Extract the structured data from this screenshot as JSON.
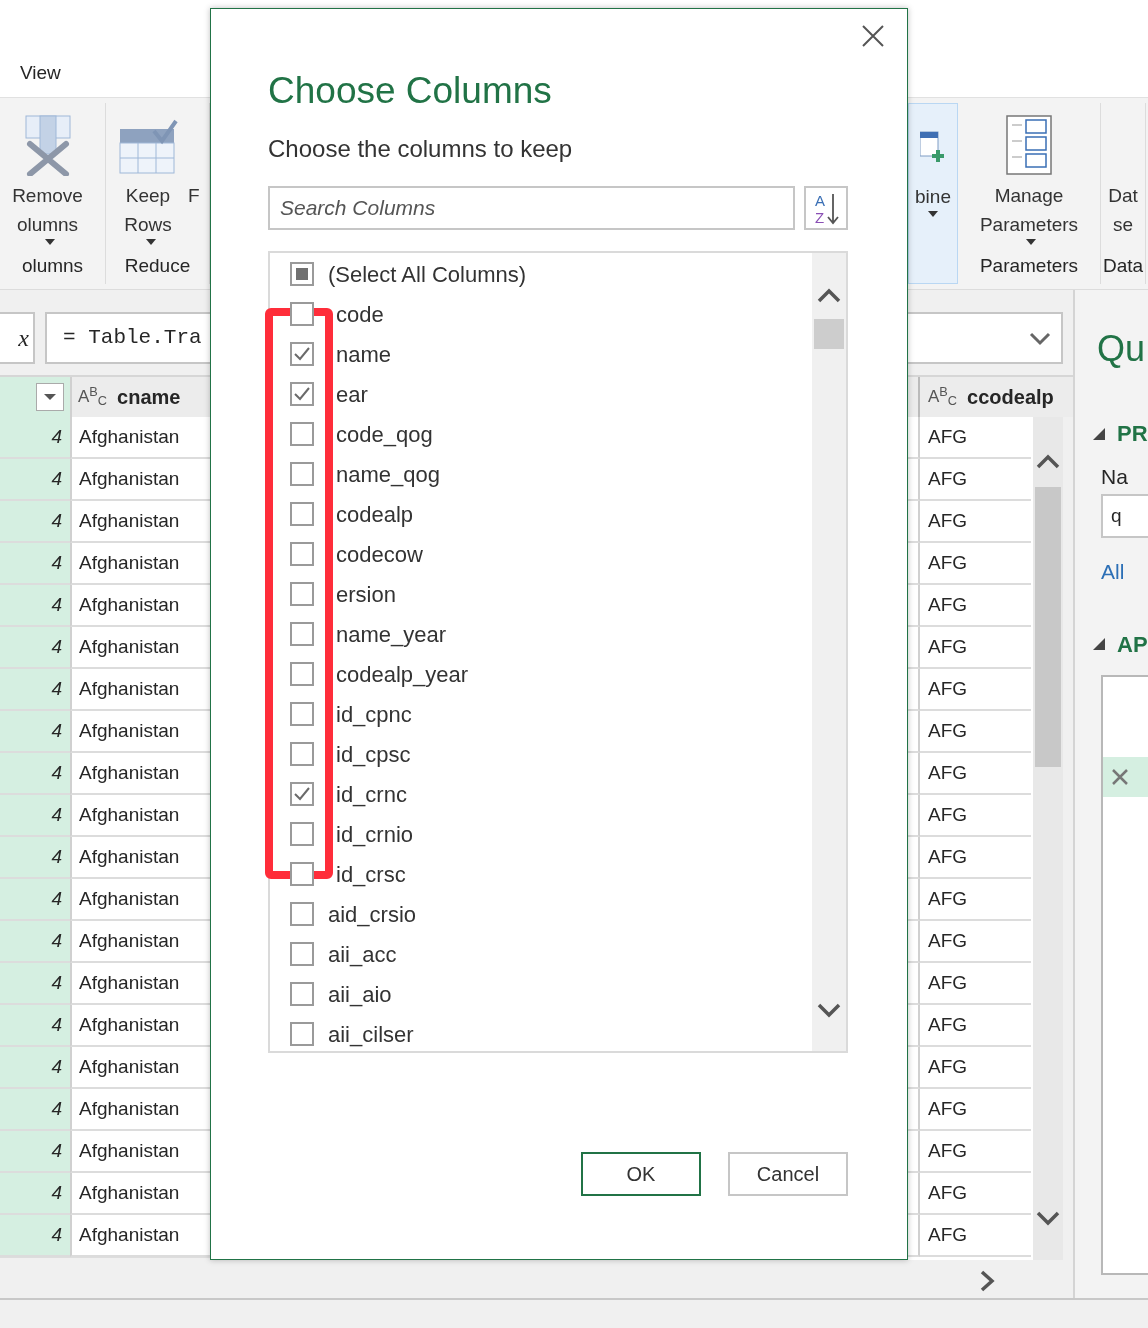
{
  "ribbon": {
    "tab": "View",
    "groups": [
      {
        "label": "olumns",
        "highlighted": false,
        "buttons": [
          {
            "kind": "remove",
            "lines": [
              "Remove",
              "olumns"
            ],
            "dropdown": true
          }
        ]
      },
      {
        "label": "Reduce",
        "highlighted": false,
        "buttons": [
          {
            "kind": "keep",
            "lines": [
              "Keep",
              "Rows"
            ],
            "dropdown": true
          },
          {
            "kind": "text",
            "lines": [
              "F"
            ],
            "dropdown": false
          }
        ]
      },
      {
        "highlighted": true,
        "buttons": [
          {
            "kind": "combine",
            "lines": [
              "bine"
            ],
            "dropdown": true
          }
        ]
      },
      {
        "label": "Parameters",
        "highlighted": false,
        "buttons": [
          {
            "kind": "params",
            "lines": [
              "Manage",
              "Parameters"
            ],
            "dropdown": true
          }
        ]
      },
      {
        "label": "Data",
        "highlighted": false,
        "buttons": [
          {
            "kind": "text",
            "lines": [
              "Dat",
              "se"
            ],
            "dropdown": false
          }
        ]
      }
    ]
  },
  "formula_bar": {
    "fx": "x",
    "formula": "= Table.Tra"
  },
  "grid": {
    "columns": [
      {
        "selected": true
      },
      {
        "type_badge": "A$^{B}$$_{C}$",
        "title": "cname",
        "selected": false
      },
      {
        "type_badge": "A$^{B}$$_{C}$",
        "title": "ccodealp",
        "selected": false
      }
    ],
    "rows": [
      [
        "4",
        "Afghanistan",
        "AFG"
      ],
      [
        "4",
        "Afghanistan",
        "AFG"
      ],
      [
        "4",
        "Afghanistan",
        "AFG"
      ],
      [
        "4",
        "Afghanistan",
        "AFG"
      ],
      [
        "4",
        "Afghanistan",
        "AFG"
      ],
      [
        "4",
        "Afghanistan",
        "AFG"
      ],
      [
        "4",
        "Afghanistan",
        "AFG"
      ],
      [
        "4",
        "Afghanistan",
        "AFG"
      ],
      [
        "4",
        "Afghanistan",
        "AFG"
      ],
      [
        "4",
        "Afghanistan",
        "AFG"
      ],
      [
        "4",
        "Afghanistan",
        "AFG"
      ],
      [
        "4",
        "Afghanistan",
        "AFG"
      ],
      [
        "4",
        "Afghanistan",
        "AFG"
      ],
      [
        "4",
        "Afghanistan",
        "AFG"
      ],
      [
        "4",
        "Afghanistan",
        "AFG"
      ],
      [
        "4",
        "Afghanistan",
        "AFG"
      ],
      [
        "4",
        "Afghanistan",
        "AFG"
      ],
      [
        "4",
        "Afghanistan",
        "AFG"
      ],
      [
        "4",
        "Afghanistan",
        "AFG"
      ],
      [
        "4",
        "Afghanistan",
        "AFG"
      ]
    ]
  },
  "query_settings": {
    "title": "Qu",
    "properties": {
      "heading": "PR",
      "expanded": true,
      "name_label": "Na",
      "name_value": "q",
      "link": "All"
    },
    "applied_steps": {
      "heading": "AP",
      "expanded": true,
      "steps": [
        {
          "selected": false
        },
        {
          "selected": false
        },
        {
          "selected": true
        }
      ]
    }
  },
  "dialog": {
    "title": "Choose Columns",
    "subtitle": "Choose the columns to keep",
    "search": {
      "placeholder": "Search Columns"
    },
    "sort_button": {
      "top": "A",
      "bottom": "Z"
    },
    "select_all": {
      "label": "(Select All Columns)",
      "checked": false,
      "partial": true
    },
    "columns": [
      {
        "name": "code",
        "checked": false
      },
      {
        "name": "name",
        "checked": true
      },
      {
        "name": "ear",
        "checked": true
      },
      {
        "name": "code_qog",
        "checked": false
      },
      {
        "name": "name_qog",
        "checked": false
      },
      {
        "name": "codealp",
        "checked": false
      },
      {
        "name": "codecow",
        "checked": false
      },
      {
        "name": "ersion",
        "checked": false
      },
      {
        "name": "name_year",
        "checked": false
      },
      {
        "name": "codealp_year",
        "checked": false
      },
      {
        "name": "id_cpnc",
        "checked": false
      },
      {
        "name": "id_cpsc",
        "checked": false
      },
      {
        "name": "id_crnc",
        "checked": true
      },
      {
        "name": "id_crnio",
        "checked": false
      },
      {
        "name": "id_crsc",
        "checked": false
      },
      {
        "name": "aid_crsio",
        "checked": false
      },
      {
        "name": "aii_acc",
        "checked": false
      },
      {
        "name": "aii_aio",
        "checked": false
      },
      {
        "name": "aii_cilser",
        "checked": false
      }
    ],
    "buttons": [
      {
        "label": "OK",
        "default": true
      },
      {
        "label": "Cancel",
        "default": false
      }
    ]
  }
}
